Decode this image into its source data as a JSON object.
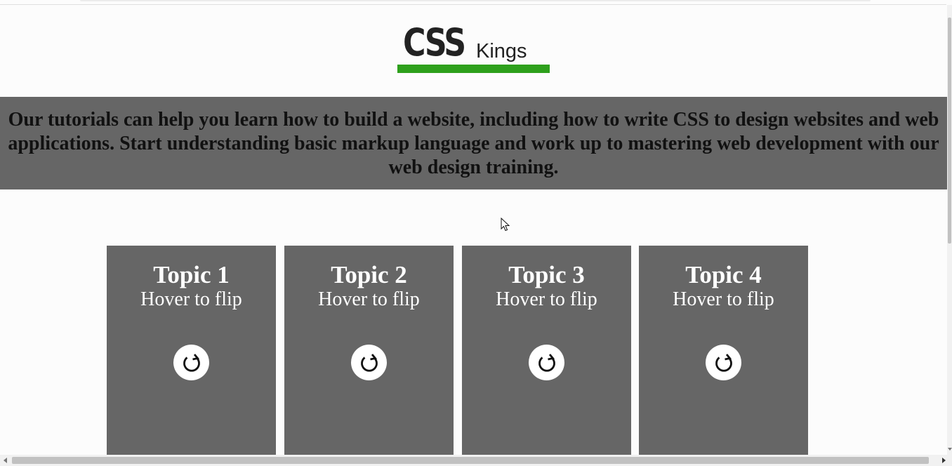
{
  "logo": {
    "main_text": "CSS",
    "sub_text": "Kings",
    "bar_color": "#2ea01c"
  },
  "intro": {
    "text": "Our tutorials can help you learn how to build a website, including how to write CSS to design websites and web applications. Start understanding basic markup language and work up to mastering web development with our web design training."
  },
  "cards": [
    {
      "title": "Topic 1",
      "subtitle": "Hover to flip",
      "icon": "refresh-icon"
    },
    {
      "title": "Topic 2",
      "subtitle": "Hover to flip",
      "icon": "refresh-icon"
    },
    {
      "title": "Topic 3",
      "subtitle": "Hover to flip",
      "icon": "refresh-icon"
    },
    {
      "title": "Topic 4",
      "subtitle": "Hover to flip",
      "icon": "refresh-icon"
    }
  ],
  "colors": {
    "page_background": "#fcfcfc",
    "panel_gray": "#666666",
    "card_text": "#ffffff"
  }
}
